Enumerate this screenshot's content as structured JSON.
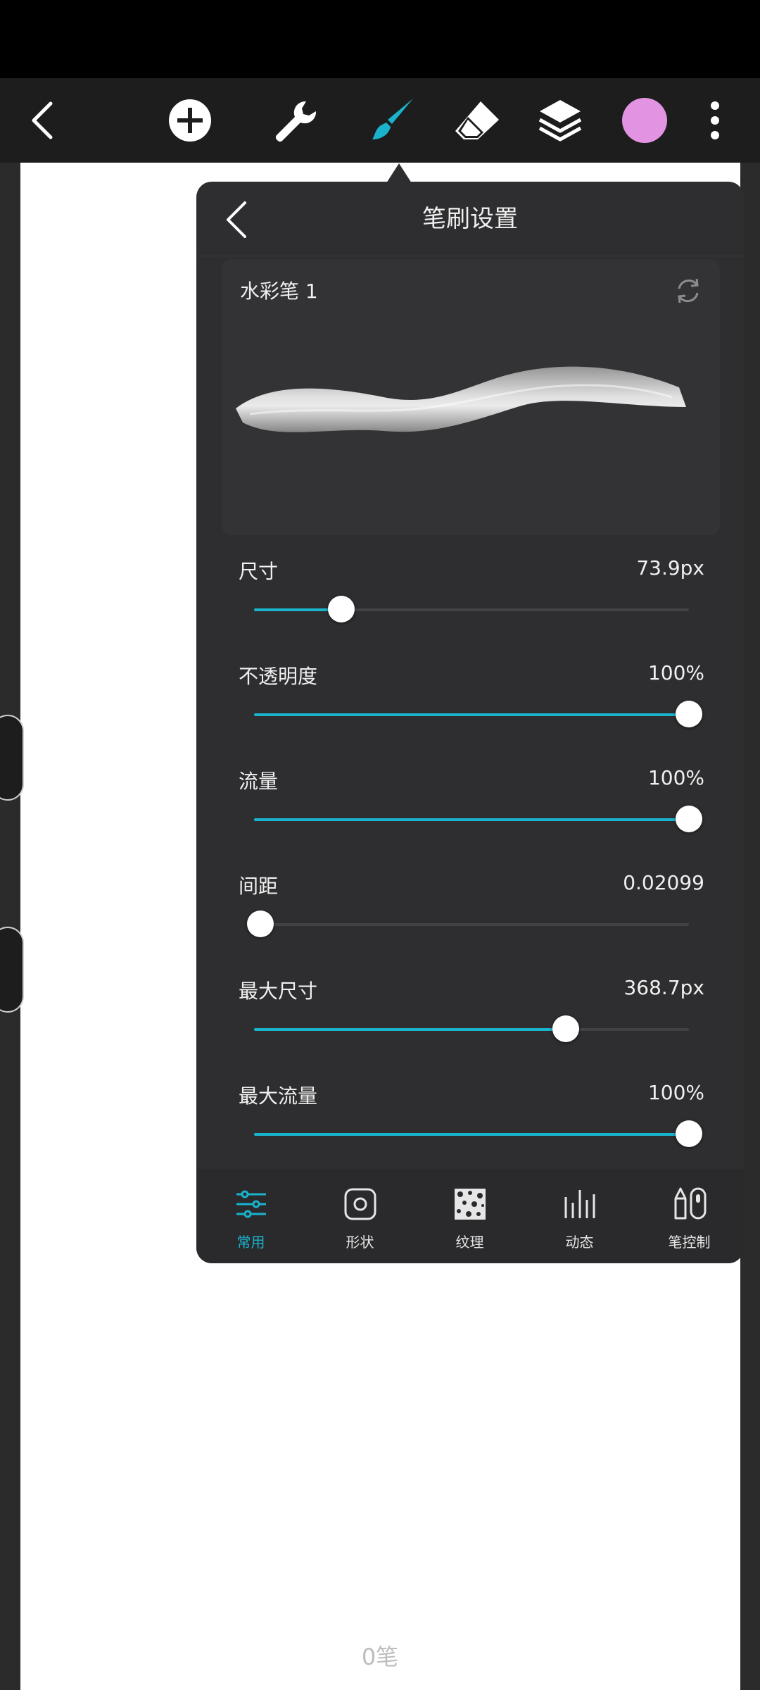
{
  "toolbar": {
    "items": [
      "back-icon",
      "add-icon",
      "wrench-icon",
      "brush-icon",
      "eraser-icon",
      "layers-icon",
      "color-swatch",
      "more-icon"
    ],
    "active_item": "brush-icon",
    "accent_color": "#19b3cc",
    "current_color": "#e294e2"
  },
  "panel": {
    "title": "笔刷设置",
    "brush_name": "水彩笔 1",
    "sliders": [
      {
        "label": "尺寸",
        "value": "73.9px",
        "fraction": 0.2
      },
      {
        "label": "不透明度",
        "value": "100%",
        "fraction": 1.0
      },
      {
        "label": "流量",
        "value": "100%",
        "fraction": 1.0
      },
      {
        "label": "间距",
        "value": "0.02099",
        "fraction": 0.015
      },
      {
        "label": "最大尺寸",
        "value": "368.7px",
        "fraction": 0.717
      },
      {
        "label": "最大流量",
        "value": "100%",
        "fraction": 1.0
      }
    ],
    "tabs": [
      {
        "label": "常用",
        "icon": "sliders-icon",
        "active": true
      },
      {
        "label": "形状",
        "icon": "shape-icon",
        "active": false
      },
      {
        "label": "纹理",
        "icon": "texture-icon",
        "active": false
      },
      {
        "label": "动态",
        "icon": "dynamics-icon",
        "active": false
      },
      {
        "label": "笔控制",
        "icon": "pen-control-icon",
        "active": false
      }
    ]
  },
  "canvas": {
    "stroke_count": "0笔"
  }
}
